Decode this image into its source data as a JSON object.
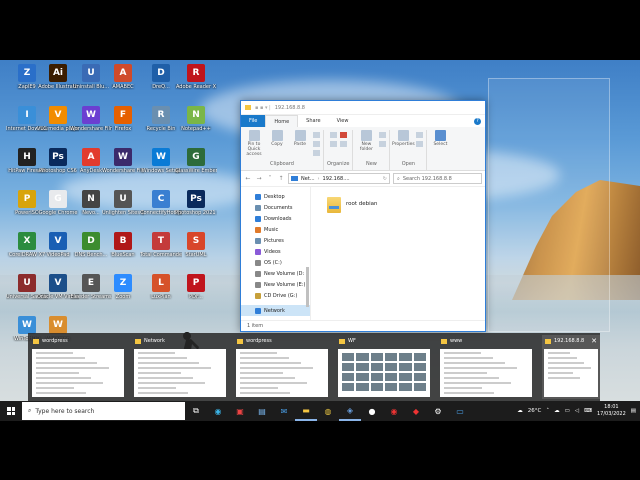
{
  "desktop": {
    "icons": [
      {
        "label": "ZaplE9",
        "color": "#2a6fc9",
        "glyph": "Z"
      },
      {
        "label": "Adobe Illustrato",
        "color": "#3b1d00",
        "glyph": "Ai"
      },
      {
        "label": "Uninstall Blu...",
        "color": "#3a6bb5",
        "glyph": "U"
      },
      {
        "label": "AMABEC",
        "color": "#d04a2a",
        "glyph": "A"
      },
      {
        "label": "DreQ...",
        "color": "#1f5fa8",
        "glyph": "D"
      },
      {
        "label": "Adobe Reader X",
        "color": "#c0141c",
        "glyph": "R"
      },
      {
        "label": "Internet Download...",
        "color": "#3a8fd8",
        "glyph": "I"
      },
      {
        "label": "VLC media player",
        "color": "#f28c00",
        "glyph": "V"
      },
      {
        "label": "Wondershare Filmora X",
        "color": "#6b3fd1",
        "glyph": "W"
      },
      {
        "label": "Firefox",
        "color": "#e66000",
        "glyph": "F"
      },
      {
        "label": "Recycle Bin",
        "color": "#6a8fb0",
        "glyph": "R"
      },
      {
        "label": "Notepad++",
        "color": "#7ab648",
        "glyph": "N"
      },
      {
        "label": "HitPaw Firewall",
        "color": "#222",
        "glyph": "H"
      },
      {
        "label": "Photoshop CS6",
        "color": "#0a2a5c",
        "glyph": "Ps"
      },
      {
        "label": "AnyDesk",
        "color": "#e23b2e",
        "glyph": "A"
      },
      {
        "label": "Wondershare Filmora9",
        "color": "#3b2a6b",
        "glyph": "W"
      },
      {
        "label": "Windows Setup",
        "color": "#0a7bd6",
        "glyph": "W"
      },
      {
        "label": "GlassWire Ember",
        "color": "#2d6b3a",
        "glyph": "G"
      },
      {
        "label": "PowerISO",
        "color": "#d8a40b",
        "glyph": "P"
      },
      {
        "label": "Google Chrome",
        "color": "#e8eaed",
        "glyph": "G"
      },
      {
        "label": "Nevo...",
        "color": "#444",
        "glyph": "N"
      },
      {
        "label": "Unlighten Sites Group",
        "color": "#555",
        "glyph": "U"
      },
      {
        "label": "ConnectifyHotspot",
        "color": "#3a7fd1",
        "glyph": "C"
      },
      {
        "label": "Photoshop 2021 x64",
        "color": "#0a2a5c",
        "glyph": "Ps"
      },
      {
        "label": "CorelDRAW X7",
        "color": "#2c8c3f",
        "glyph": "X"
      },
      {
        "label": "VideoPad",
        "color": "#1a5fb4",
        "glyph": "V"
      },
      {
        "label": "DNS Bench...",
        "color": "#3c8c2f",
        "glyph": "D"
      },
      {
        "label": "BlueScan",
        "color": "#b01818",
        "glyph": "B"
      },
      {
        "label": "Total Commander",
        "color": "#c43b3b",
        "glyph": "T"
      },
      {
        "label": "StarUML",
        "color": "#d8462a",
        "glyph": "S"
      },
      {
        "label": "Universal Sandbox",
        "color": "#8c2c2c",
        "glyph": "U"
      },
      {
        "label": "Oracle VM VirtualBox",
        "color": "#1c4f8a",
        "glyph": "V"
      },
      {
        "label": "Eleeder Streams",
        "color": "#555",
        "glyph": "E"
      },
      {
        "label": "Zoom",
        "color": "#2d8cff",
        "glyph": "Z"
      },
      {
        "label": "LuxPlan",
        "color": "#d6522a",
        "glyph": "L"
      },
      {
        "label": "PDF...",
        "color": "#c0141c",
        "glyph": "P"
      },
      {
        "label": "WinToHDD",
        "color": "#3a8fd8",
        "glyph": "W"
      },
      {
        "label": "Winampp",
        "color": "#d98d2e",
        "glyph": "W"
      }
    ]
  },
  "explorer": {
    "title_path": "192.168.8.8",
    "tabs": [
      "File",
      "Home",
      "Share",
      "View"
    ],
    "help": "?",
    "ribbon": {
      "clipboard": {
        "label": "Clipboard",
        "buttons": [
          "Pin to Quick access",
          "Copy",
          "Paste"
        ]
      },
      "organize": {
        "label": "Organize"
      },
      "new": {
        "label": "New",
        "buttons": [
          "New folder"
        ]
      },
      "open": {
        "label": "Open",
        "buttons": [
          "Properties"
        ]
      },
      "select": {
        "label": "",
        "buttons": [
          "Select"
        ]
      }
    },
    "address": {
      "seg1": "Net...",
      "seg2": "192.168....",
      "search_placeholder": "Search 192.168.8.8"
    },
    "nav": [
      {
        "label": "Desktop",
        "color": "#2f7ed8"
      },
      {
        "label": "Documents",
        "color": "#6a8fb0"
      },
      {
        "label": "Downloads",
        "color": "#2f7ed8"
      },
      {
        "label": "Music",
        "color": "#e07a2a"
      },
      {
        "label": "Pictures",
        "color": "#6a8fb0"
      },
      {
        "label": "Videos",
        "color": "#8a5ad8"
      },
      {
        "label": "OS (C:)",
        "color": "#888"
      },
      {
        "label": "New Volume (D:",
        "color": "#888"
      },
      {
        "label": "New Volume (E:)",
        "color": "#888"
      },
      {
        "label": "CD Drive (G:)",
        "color": "#c7a03a"
      },
      {
        "label": "Network",
        "color": "#2f7ed8"
      }
    ],
    "folder_name": "root debian",
    "status": "1 item"
  },
  "previews": [
    {
      "title": "wordpress",
      "kind": "list"
    },
    {
      "title": "Network",
      "kind": "list"
    },
    {
      "title": "wordpress",
      "kind": "list"
    },
    {
      "title": "WF",
      "kind": "thumbs"
    },
    {
      "title": "www",
      "kind": "list"
    },
    {
      "title": "192.168.8.8",
      "kind": "small",
      "close": "✕"
    }
  ],
  "taskbar": {
    "search_placeholder": "Type here to search",
    "temperature": "26°C",
    "time": "18:01",
    "date": "17/03/2022"
  },
  "colors": {
    "accent": "#1979ca",
    "taskbar": "#1c1c1c"
  }
}
